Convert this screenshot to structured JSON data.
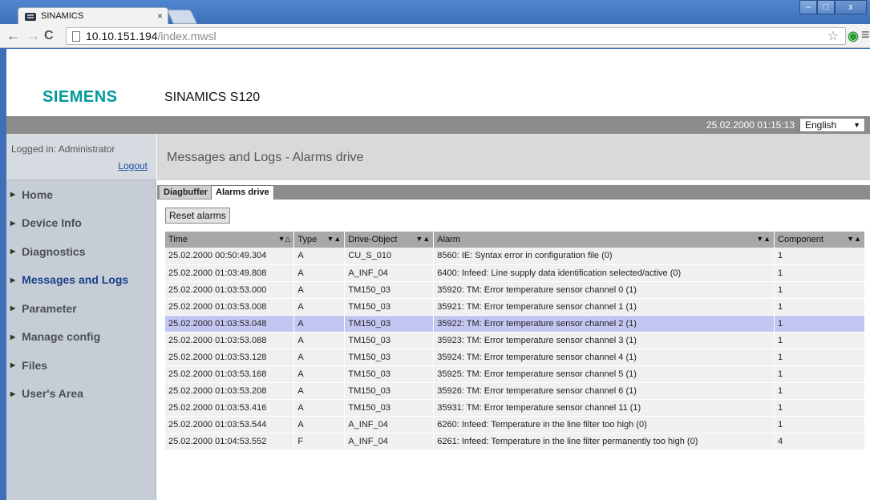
{
  "browser": {
    "tab_title": "SINAMICS",
    "tab_close": "×",
    "url_host": "10.10.151.194",
    "url_path": "/index.mwsl",
    "window_controls": [
      "–",
      "□",
      "x"
    ]
  },
  "header": {
    "logo": "SIEMENS",
    "product": "SINAMICS S120",
    "datetime": "25.02.2000 01:15:13",
    "language": "English"
  },
  "sidebar": {
    "logged_in": "Logged in: Administrator",
    "logout": "Logout",
    "items": [
      {
        "label": "Home"
      },
      {
        "label": "Device Info"
      },
      {
        "label": "Diagnostics"
      },
      {
        "label": "Messages and Logs"
      },
      {
        "label": "Parameter"
      },
      {
        "label": "Manage config"
      },
      {
        "label": "Files"
      },
      {
        "label": "User's Area"
      }
    ],
    "active_index": 3
  },
  "content": {
    "title": "Messages and Logs - Alarms drive",
    "tabs": [
      "Diagbuffer",
      "Alarms drive"
    ],
    "active_tab": 1,
    "reset_button": "Reset alarms",
    "columns": [
      "Time",
      "Type",
      "Drive-Object",
      "Alarm",
      "Component"
    ],
    "rows": [
      {
        "time": "25.02.2000 00:50:49.304",
        "type": "A",
        "drive": "CU_S_010",
        "alarm": "8560: IE: Syntax error in configuration file (0)",
        "component": "1"
      },
      {
        "time": "25.02.2000 01:03:49.808",
        "type": "A",
        "drive": "A_INF_04",
        "alarm": "6400: Infeed: Line supply data identification selected/active (0)",
        "component": "1"
      },
      {
        "time": "25.02.2000 01:03:53.000",
        "type": "A",
        "drive": "TM150_03",
        "alarm": "35920: TM: Error temperature sensor channel 0 (1)",
        "component": "1"
      },
      {
        "time": "25.02.2000 01:03:53.008",
        "type": "A",
        "drive": "TM150_03",
        "alarm": "35921: TM: Error temperature sensor channel 1 (1)",
        "component": "1"
      },
      {
        "time": "25.02.2000 01:03:53.048",
        "type": "A",
        "drive": "TM150_03",
        "alarm": "35922: TM: Error temperature sensor channel 2 (1)",
        "component": "1"
      },
      {
        "time": "25.02.2000 01:03:53.088",
        "type": "A",
        "drive": "TM150_03",
        "alarm": "35923: TM: Error temperature sensor channel 3 (1)",
        "component": "1"
      },
      {
        "time": "25.02.2000 01:03:53.128",
        "type": "A",
        "drive": "TM150_03",
        "alarm": "35924: TM: Error temperature sensor channel 4 (1)",
        "component": "1"
      },
      {
        "time": "25.02.2000 01:03:53.168",
        "type": "A",
        "drive": "TM150_03",
        "alarm": "35925: TM: Error temperature sensor channel 5 (1)",
        "component": "1"
      },
      {
        "time": "25.02.2000 01:03:53.208",
        "type": "A",
        "drive": "TM150_03",
        "alarm": "35926: TM: Error temperature sensor channel 6 (1)",
        "component": "1"
      },
      {
        "time": "25.02.2000 01:03:53.416",
        "type": "A",
        "drive": "TM150_03",
        "alarm": "35931: TM: Error temperature sensor channel 11 (1)",
        "component": "1"
      },
      {
        "time": "25.02.2000 01:03:53.544",
        "type": "A",
        "drive": "A_INF_04",
        "alarm": "6260: Infeed: Temperature in the line filter too high (0)",
        "component": "1"
      },
      {
        "time": "25.02.2000 01:04:53.552",
        "type": "F",
        "drive": "A_INF_04",
        "alarm": "6261: Infeed: Temperature in the line filter permanently too high (0)",
        "component": "4"
      }
    ],
    "selected_row": 4
  },
  "colors": {
    "brand": "#009999",
    "selected_row": "#c4c6f2",
    "header_bar": "#8c8c8c"
  }
}
